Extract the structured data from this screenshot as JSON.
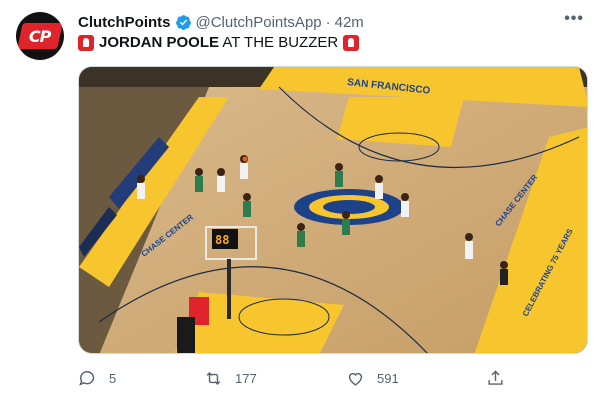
{
  "tweet": {
    "author_name": "ClutchPoints",
    "author_handle": "@ClutchPointsApp",
    "separator": "·",
    "time": "42m",
    "avatar_text": "CP",
    "text_bold": "JORDAN POOLE",
    "text_rest": " AT THE BUZZER"
  },
  "media": {
    "court_text_top": "SAN FRANCISCO",
    "court_text_left": "CHASE CENTER",
    "court_text_right": "CHASE CENTER",
    "court_text_banner": "CELEBRATING 75 YEARS",
    "shot_clock": "88"
  },
  "actions": {
    "replies": "5",
    "retweets": "177",
    "likes": "591"
  },
  "colors": {
    "brand_red": "#e0242c",
    "verified_blue": "#1d9bf0",
    "court_yellow": "#f7c62f",
    "court_blue": "#1d428a"
  }
}
